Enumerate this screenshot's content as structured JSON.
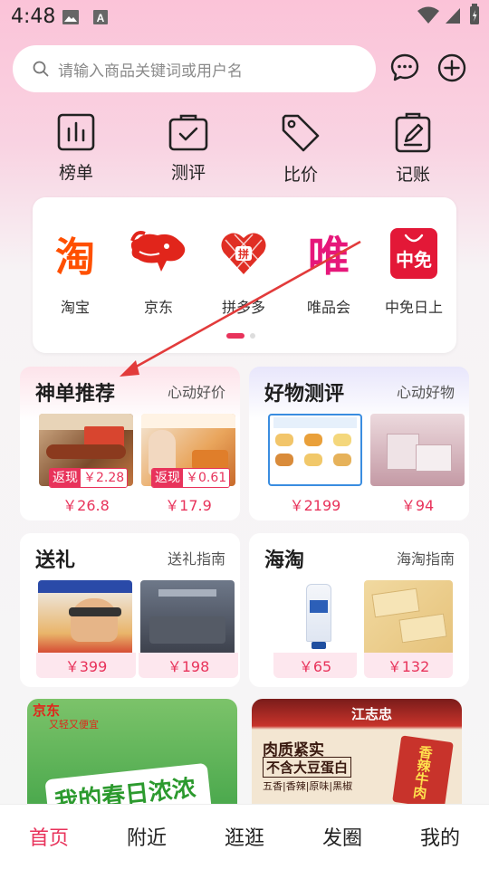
{
  "status_bar": {
    "time": "4:48"
  },
  "search": {
    "placeholder": "请输入商品关键词或用户名"
  },
  "shortcuts": [
    {
      "label": "榜单",
      "icon": "chart-icon"
    },
    {
      "label": "测评",
      "icon": "clipboard-check-icon"
    },
    {
      "label": "比价",
      "icon": "price-tag-icon"
    },
    {
      "label": "记账",
      "icon": "notebook-pen-icon"
    }
  ],
  "platforms": [
    {
      "label": "淘宝",
      "logo_text": "淘"
    },
    {
      "label": "京东",
      "logo_text": ""
    },
    {
      "label": "拼多多",
      "logo_text": "拼"
    },
    {
      "label": "唯品会",
      "logo_text": "唯"
    },
    {
      "label": "中免日上",
      "logo_text": "中免"
    }
  ],
  "cards": {
    "recommend": {
      "title": "神单推荐",
      "subtitle": "心动好价",
      "items": [
        {
          "rebate_tag": "返现",
          "rebate": "￥2.28",
          "price": "￥26.8"
        },
        {
          "rebate_tag": "返现",
          "rebate": "￥0.61",
          "price": "￥17.9"
        }
      ]
    },
    "review": {
      "title": "好物测评",
      "subtitle": "心动好物",
      "items": [
        {
          "price": "￥2199"
        },
        {
          "price": "￥94"
        }
      ]
    },
    "gift": {
      "title": "送礼",
      "subtitle": "送礼指南",
      "items": [
        {
          "price": "￥399"
        },
        {
          "price": "￥198"
        }
      ]
    },
    "haitao": {
      "title": "海淘",
      "subtitle": "海淘指南",
      "items": [
        {
          "price": "￥65"
        },
        {
          "price": "￥132"
        }
      ]
    }
  },
  "banners": {
    "left": {
      "brand": "京东",
      "tagline": "又轻又便宜",
      "headline": "我的春日浓浓"
    },
    "right": {
      "brand": "江志忠",
      "line1": "肉质紧实",
      "line2": "不含大豆蛋白",
      "line3": "五香|香辣|原味|黑椒",
      "product": "香辣牛肉"
    }
  },
  "bottom_nav": [
    {
      "label": "首页",
      "active": true
    },
    {
      "label": "附近",
      "active": false
    },
    {
      "label": "逛逛",
      "active": false
    },
    {
      "label": "发圈",
      "active": false
    },
    {
      "label": "我的",
      "active": false
    }
  ],
  "colors": {
    "accent": "#e8335b",
    "taobao": "#ff5000",
    "jd": "#e1251b",
    "pdd": "#e02e24",
    "vip": "#e6177a",
    "cdf": "#e31837"
  }
}
